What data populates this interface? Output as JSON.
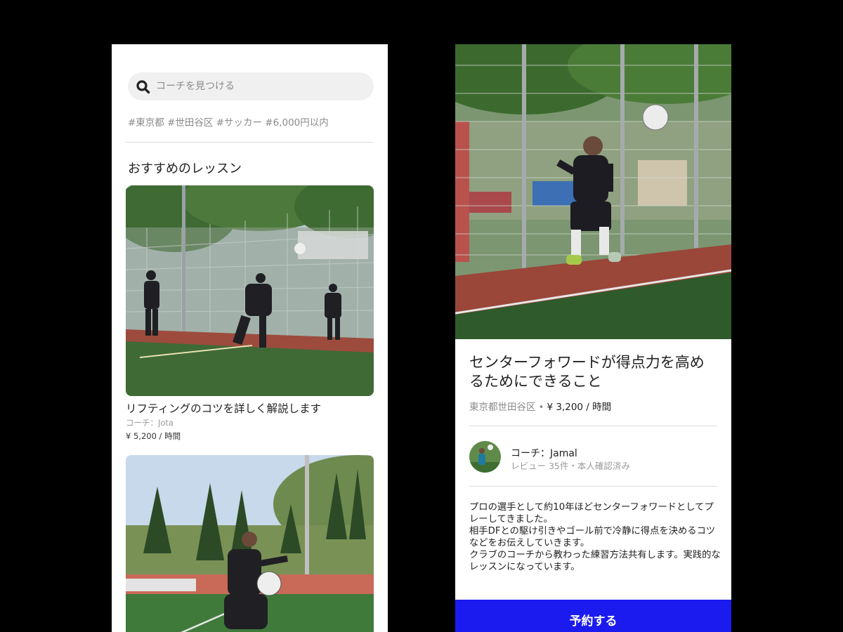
{
  "search": {
    "placeholder": "コーチを見つける",
    "tags": "#東京都 #世田谷区 #サッカー #6,000円以内"
  },
  "recommendations": {
    "title": "おすすめのレッスン",
    "cards": [
      {
        "title": "リフティングのコツを詳しく解説します",
        "coach": "コーチ：Jota",
        "price": "¥ 5,200 / 時間"
      },
      {
        "title": "",
        "coach": "",
        "price": ""
      }
    ]
  },
  "detail": {
    "title": "センターフォワードが得点力を高めるためにできること",
    "location": "東京都世田谷区",
    "separator": "•",
    "price": "¥ 3,200 / 時間",
    "coach_name": "コーチ：Jamal",
    "coach_meta": "レビュー 35件・本人確認済み",
    "description": "プロの選手として約10年ほどセンターフォワードとしてプレーしてきました。\n相手DFとの駆け引きやゴール前で冷静に得点を決めるコツなどをお伝えしていきます。\nクラブのコーチから教わった練習方法共有します。実践的なレッスンになっています。",
    "cta_label": "予約する"
  },
  "colors": {
    "background": "#000000",
    "screen": "#ffffff",
    "accent": "#1b1bf0",
    "muted_text": "#8a8a8a",
    "search_bg": "#f0f0f0"
  },
  "icons": [
    "search-icon"
  ]
}
